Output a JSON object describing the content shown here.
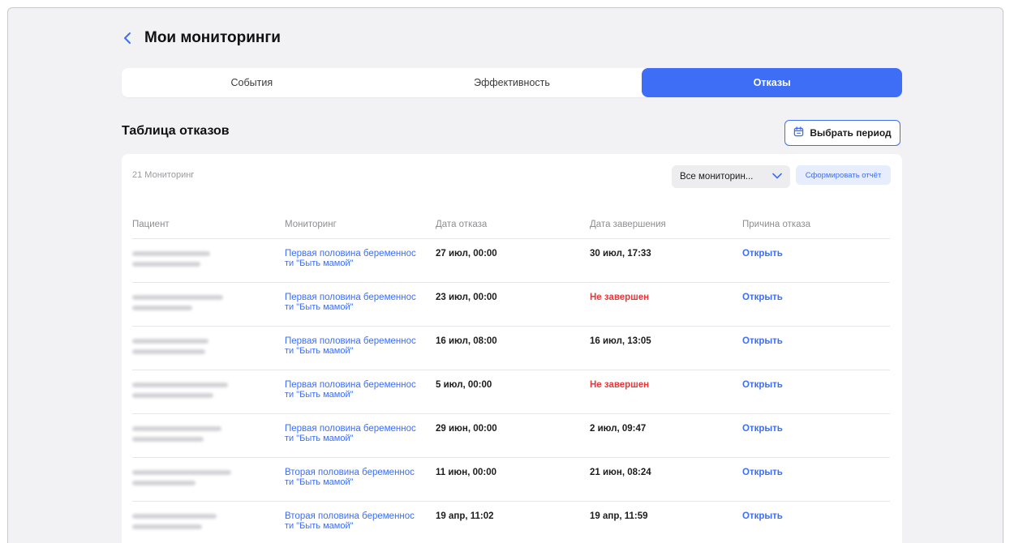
{
  "header": {
    "title": "Мои мониторинги"
  },
  "tabs": [
    {
      "label": "События",
      "active": false
    },
    {
      "label": "Эффективность",
      "active": false
    },
    {
      "label": "Отказы",
      "active": true
    }
  ],
  "section": {
    "title": "Таблица отказов",
    "period_button": "Выбрать период"
  },
  "toolbar": {
    "count_label": "21 Мониторинг",
    "filter_value": "Все мониторин...",
    "report_button": "Сформировать отчёт"
  },
  "table": {
    "columns": [
      "Пациент",
      "Мониторинг",
      "Дата отказа",
      "Дата завершения",
      "Причина отказа"
    ],
    "rows": [
      {
        "monitoring_line1": "Первая половина беременнос",
        "monitoring_line2": "ти \"Быть мамой\"",
        "refusal_date": "27 июл, 00:00",
        "end_date": "30 июл, 17:33",
        "end_status": "done",
        "reason": "Открыть"
      },
      {
        "monitoring_line1": "Первая половина беременнос",
        "monitoring_line2": "ти \"Быть мамой\"",
        "refusal_date": "23 июл, 00:00",
        "end_date": "Не завершен",
        "end_status": "pending",
        "reason": "Открыть"
      },
      {
        "monitoring_line1": "Первая половина беременнос",
        "monitoring_line2": "ти \"Быть мамой\"",
        "refusal_date": "16 июл, 08:00",
        "end_date": "16 июл, 13:05",
        "end_status": "done",
        "reason": "Открыть"
      },
      {
        "monitoring_line1": "Первая половина беременнос",
        "monitoring_line2": "ти \"Быть мамой\"",
        "refusal_date": "5 июл, 00:00",
        "end_date": "Не завершен",
        "end_status": "pending",
        "reason": "Открыть"
      },
      {
        "monitoring_line1": "Первая половина беременнос",
        "monitoring_line2": "ти \"Быть мамой\"",
        "refusal_date": "29 июн, 00:00",
        "end_date": "2 июл, 09:47",
        "end_status": "done",
        "reason": "Открыть"
      },
      {
        "monitoring_line1": "Вторая половина беременнос",
        "monitoring_line2": "ти \"Быть мамой\"",
        "refusal_date": "11 июн, 00:00",
        "end_date": "21 июн, 08:24",
        "end_status": "done",
        "reason": "Открыть"
      },
      {
        "monitoring_line1": "Вторая половина беременнос",
        "monitoring_line2": "ти \"Быть мамой\"",
        "refusal_date": "19 апр, 11:02",
        "end_date": "19 апр, 11:59",
        "end_status": "done",
        "reason": "Открыть"
      }
    ]
  },
  "colors": {
    "accent": "#3e6ef5",
    "danger": "#e5383b",
    "background": "#f2f2f5"
  },
  "icons": {
    "back": "chevron-left-icon",
    "calendar": "calendar-icon",
    "dropdown": "chevron-down-icon"
  }
}
